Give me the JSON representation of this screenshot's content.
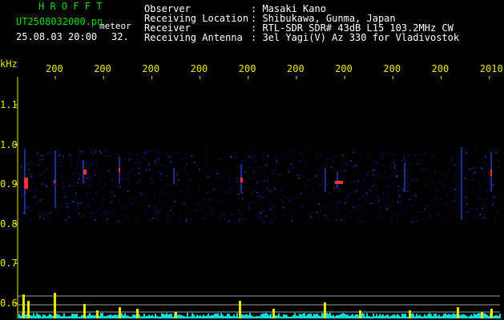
{
  "header": {
    "logo": "H R O F F T",
    "file_name": "UT2508032000.pn",
    "tag": "meteor",
    "date_time": "25.08.03 20:00",
    "count": "32.",
    "info": [
      {
        "label": "Observer",
        "value": ": Masaki Kano"
      },
      {
        "label": "Receiving Location",
        "value": ": Shibukawa, Gunma, Japan"
      },
      {
        "label": "Receiver",
        "value": ": RTL-SDR SDR# 43dB L15 103.2MHz CW"
      },
      {
        "label": "Receiving Antenna",
        "value": ": 3el Yagi(V) Az 330 for Vladivostok"
      }
    ]
  },
  "chart_data": {
    "type": "heatmap",
    "ylabel": "kHz",
    "y_ticks": [
      "1.1",
      "1.0",
      "0.9",
      "0.8",
      "0.7",
      "0.6"
    ],
    "x_ticks": [
      "200",
      "200",
      "200",
      "200",
      "200",
      "200",
      "200",
      "200",
      "200",
      "2010"
    ],
    "colors": {
      "axis": "#e8e800",
      "grid": "#a0a0a0",
      "echo_hot": "#ff3030",
      "echo": "#3050ff",
      "noise": "#0a1a80",
      "baseline": "#00e0e0",
      "counts": "#e8e800"
    }
  }
}
